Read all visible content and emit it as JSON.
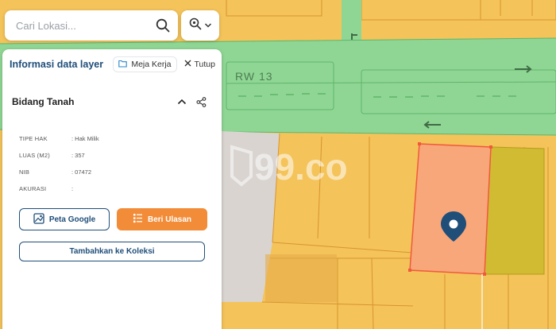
{
  "search": {
    "placeholder": "Cari Lokasi..."
  },
  "panel": {
    "title": "Informasi data layer",
    "workspace_label": "Meja Kerja",
    "close_label": "Tutup"
  },
  "section": {
    "title": "Bidang Tanah"
  },
  "attributes": [
    {
      "key": "TIPE HAK",
      "value": ": Hak Milik"
    },
    {
      "key": "LUAS (M2)",
      "value": ": 357"
    },
    {
      "key": "NIB",
      "value": ": 07472"
    },
    {
      "key": "AKURASI",
      "value": ":"
    }
  ],
  "buttons": {
    "google_map": "Peta Google",
    "review": "Beri Ulasan",
    "add_collection": "Tambahkan ke Koleksi"
  },
  "map": {
    "road_label": "RW 13",
    "watermark": "99.co",
    "colors": {
      "parcel_yellow": "#f4c35a",
      "road_green": "#8fd694",
      "selected_parcel": "#f7a77a",
      "olive_parcel": "#d0bb33",
      "marker": "#1f4e79",
      "accent_orange": "#f28c38",
      "primary_blue": "#1f4e79"
    }
  }
}
